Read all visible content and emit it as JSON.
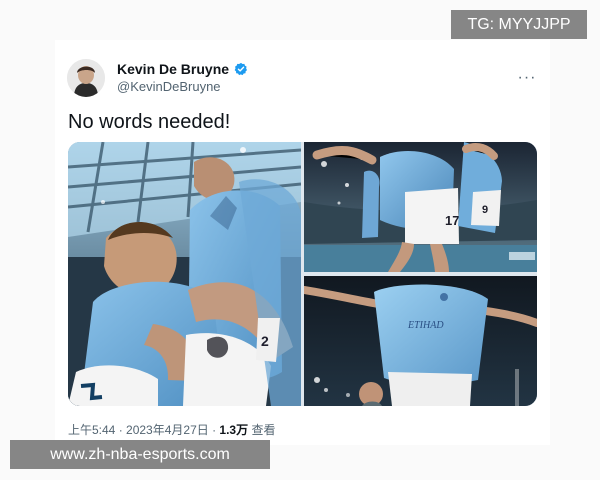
{
  "tweet": {
    "author": {
      "display_name": "Kevin De Bruyne",
      "handle": "@KevinDeBruyne",
      "verified_icon": "verified-badge-icon",
      "avatar": "avatar"
    },
    "text": "No words needed!",
    "media": {
      "photos": [
        {
          "name": "celebration-main-photo",
          "icon": "image"
        },
        {
          "name": "celebration-top-right-photo",
          "icon": "image"
        },
        {
          "name": "celebration-bottom-right-photo",
          "icon": "image"
        }
      ]
    },
    "meta": {
      "time": "上午5:44",
      "separator1": " · ",
      "date": "2023年4月27日",
      "separator2": " · ",
      "views_count": "1.3万",
      "views_label": " 查看"
    },
    "menu_icon": "more-icon",
    "menu_label": "···"
  },
  "watermarks": {
    "tg": "TG: MYYJJPP",
    "site": "www.zh-nba-esports.com"
  },
  "colors": {
    "sky_blue": "#6cabdd",
    "verified_blue": "#1d9bf0",
    "text_primary": "#0f1419",
    "text_secondary": "#536471"
  }
}
